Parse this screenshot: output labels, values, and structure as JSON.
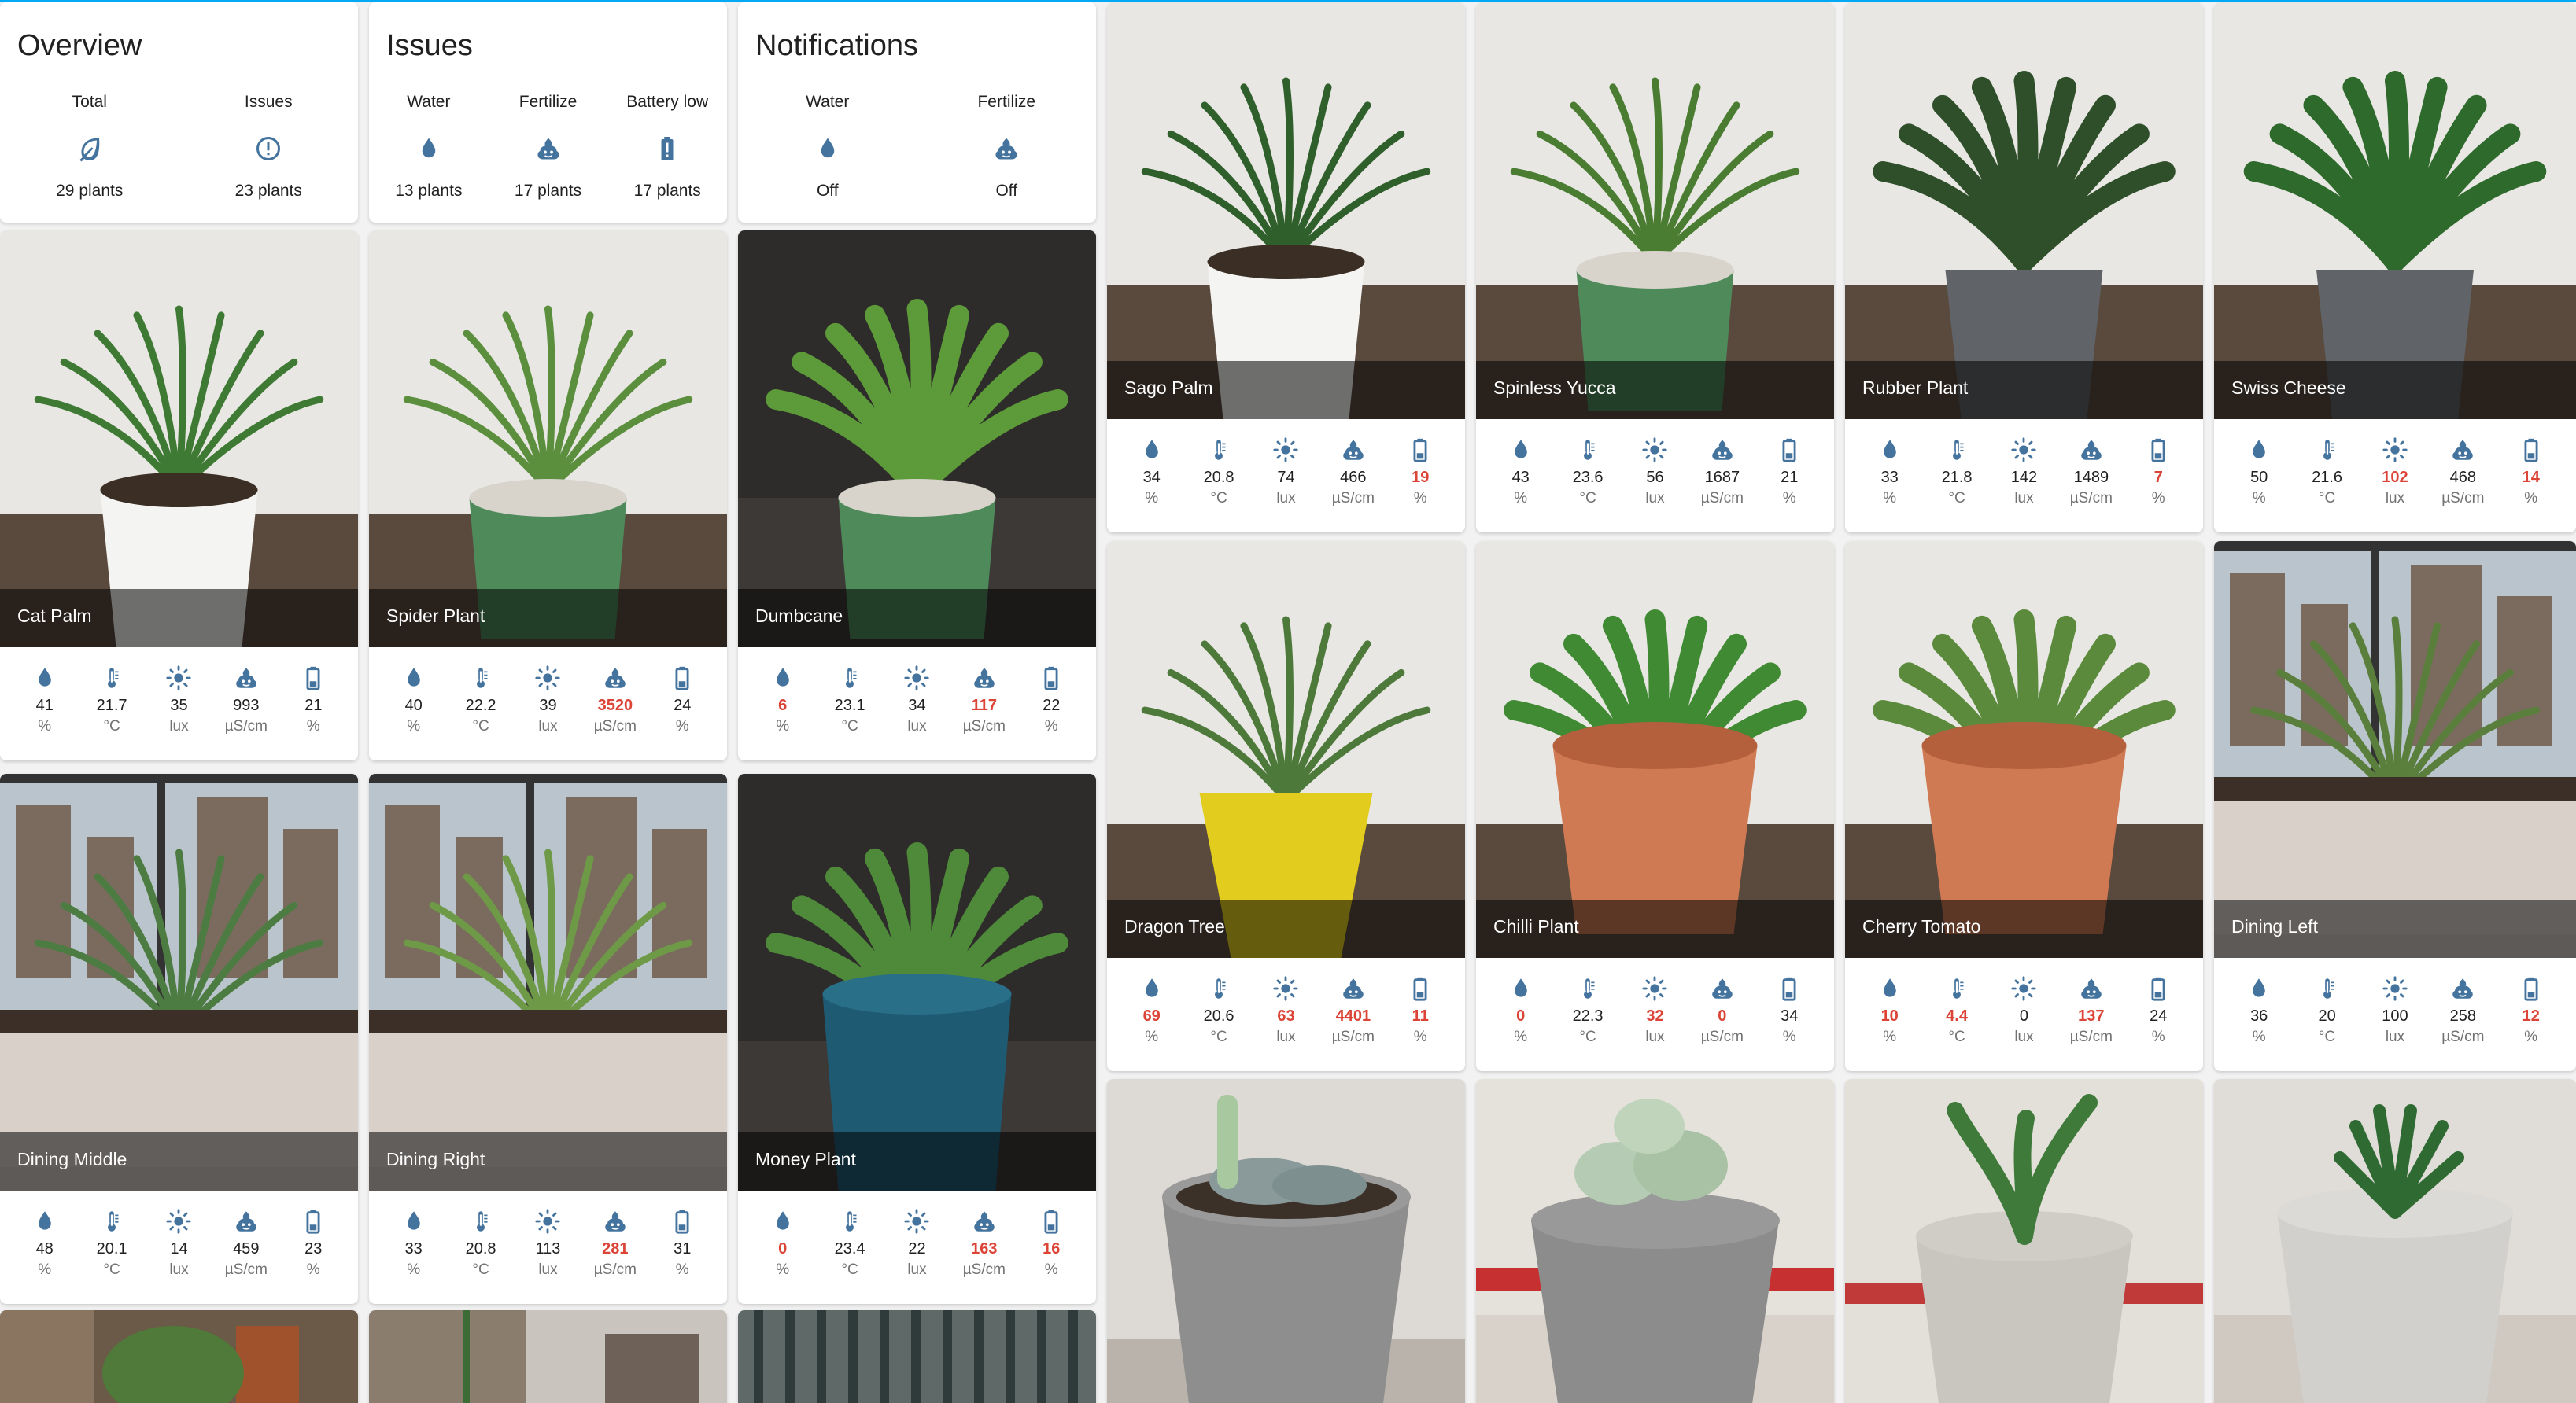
{
  "colors": {
    "icon": "#44739e",
    "alert": "#db4437",
    "header_line": "#03a9f4"
  },
  "overview": {
    "title": "Overview",
    "columns": [
      {
        "label": "Total",
        "icon": "leaf-icon",
        "value": "29 plants"
      },
      {
        "label": "Issues",
        "icon": "alert-circle-icon",
        "value": "23 plants"
      }
    ]
  },
  "issues": {
    "title": "Issues",
    "columns": [
      {
        "label": "Water",
        "icon": "water-drop-icon",
        "value": "13 plants"
      },
      {
        "label": "Fertilize",
        "icon": "fertilizer-icon",
        "value": "17 plants"
      },
      {
        "label": "Battery low",
        "icon": "battery-alert-icon",
        "value": "17 plants"
      }
    ]
  },
  "notifications": {
    "title": "Notifications",
    "columns": [
      {
        "label": "Water",
        "icon": "water-drop-icon",
        "value": "Off"
      },
      {
        "label": "Fertilize",
        "icon": "fertilizer-icon",
        "value": "Off"
      }
    ]
  },
  "metric_icons": [
    "water-drop-icon",
    "thermometer-icon",
    "sun-icon",
    "fertilizer-icon",
    "battery-icon"
  ],
  "units": [
    "%",
    "°C",
    "lux",
    "µS/cm",
    "%"
  ],
  "plants": [
    {
      "name": "Cat Palm",
      "m": [
        "41",
        "21.7",
        "35",
        "993",
        "21"
      ],
      "alert": [
        false,
        false,
        false,
        false,
        false
      ]
    },
    {
      "name": "Spider Plant",
      "m": [
        "40",
        "22.2",
        "39",
        "3520",
        "24"
      ],
      "alert": [
        false,
        false,
        false,
        true,
        false
      ]
    },
    {
      "name": "Dumbcane",
      "m": [
        "6",
        "23.1",
        "34",
        "117",
        "22"
      ],
      "alert": [
        true,
        false,
        false,
        true,
        false
      ]
    },
    {
      "name": "Dining Middle",
      "m": [
        "48",
        "20.1",
        "14",
        "459",
        "23"
      ],
      "alert": [
        false,
        false,
        false,
        false,
        false
      ]
    },
    {
      "name": "Dining Right",
      "m": [
        "33",
        "20.8",
        "113",
        "281",
        "31"
      ],
      "alert": [
        false,
        false,
        false,
        true,
        false
      ]
    },
    {
      "name": "Money Plant",
      "m": [
        "0",
        "23.4",
        "22",
        "163",
        "16"
      ],
      "alert": [
        true,
        false,
        false,
        true,
        true
      ]
    },
    {
      "name": "Sago Palm",
      "m": [
        "34",
        "20.8",
        "74",
        "466",
        "19"
      ],
      "alert": [
        false,
        false,
        false,
        false,
        true
      ]
    },
    {
      "name": "Spinless Yucca",
      "m": [
        "43",
        "23.6",
        "56",
        "1687",
        "21"
      ],
      "alert": [
        false,
        false,
        false,
        false,
        false
      ]
    },
    {
      "name": "Rubber Plant",
      "m": [
        "33",
        "21.8",
        "142",
        "1489",
        "7"
      ],
      "alert": [
        false,
        false,
        false,
        false,
        true
      ]
    },
    {
      "name": "Swiss Cheese",
      "m": [
        "50",
        "21.6",
        "102",
        "468",
        "14"
      ],
      "alert": [
        false,
        false,
        true,
        false,
        true
      ]
    },
    {
      "name": "Dragon Tree",
      "m": [
        "69",
        "20.6",
        "63",
        "4401",
        "11"
      ],
      "alert": [
        true,
        false,
        true,
        true,
        true
      ]
    },
    {
      "name": "Chilli Plant",
      "m": [
        "0",
        "22.3",
        "32",
        "0",
        "34"
      ],
      "alert": [
        true,
        false,
        true,
        true,
        false
      ]
    },
    {
      "name": "Cherry Tomato",
      "m": [
        "10",
        "4.4",
        "0",
        "137",
        "24"
      ],
      "alert": [
        true,
        true,
        false,
        true,
        false
      ]
    },
    {
      "name": "Dining Left",
      "m": [
        "36",
        "20",
        "100",
        "258",
        "12"
      ],
      "alert": [
        false,
        false,
        false,
        false,
        true
      ]
    }
  ]
}
